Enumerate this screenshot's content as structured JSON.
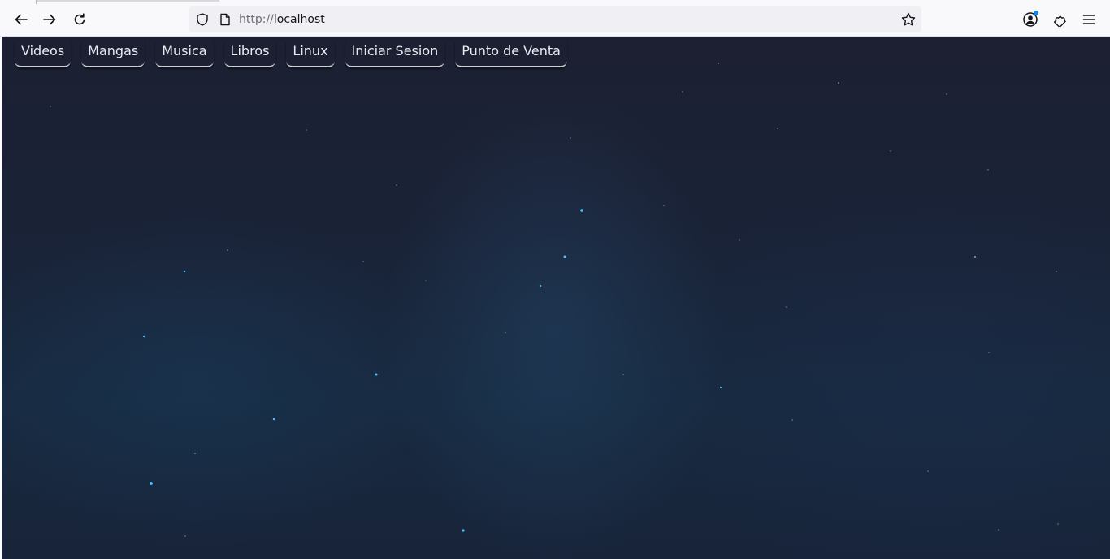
{
  "browser": {
    "url_protocol": "http://",
    "url_host": "localhost"
  },
  "site_nav": {
    "items": [
      {
        "label": "Videos"
      },
      {
        "label": "Mangas"
      },
      {
        "label": "Musica"
      },
      {
        "label": "Libros"
      },
      {
        "label": "Linux"
      },
      {
        "label": "Iniciar Sesion"
      },
      {
        "label": "Punto de Venta"
      }
    ]
  },
  "icons": {
    "back": "back-arrow-icon",
    "forward": "forward-arrow-icon",
    "reload": "reload-icon",
    "tracking_protection": "shield-icon",
    "page_info": "page-icon",
    "bookmark": "star-icon",
    "account": "account-icon",
    "extensions": "puzzle-icon",
    "menu": "hamburger-menu-icon"
  },
  "colors": {
    "background_top": "#1c2032",
    "background_bottom": "#18243a",
    "menu_text": "#e8ebef",
    "star_blue": "#4fc3ff",
    "account_badge": "#0a84ff"
  }
}
